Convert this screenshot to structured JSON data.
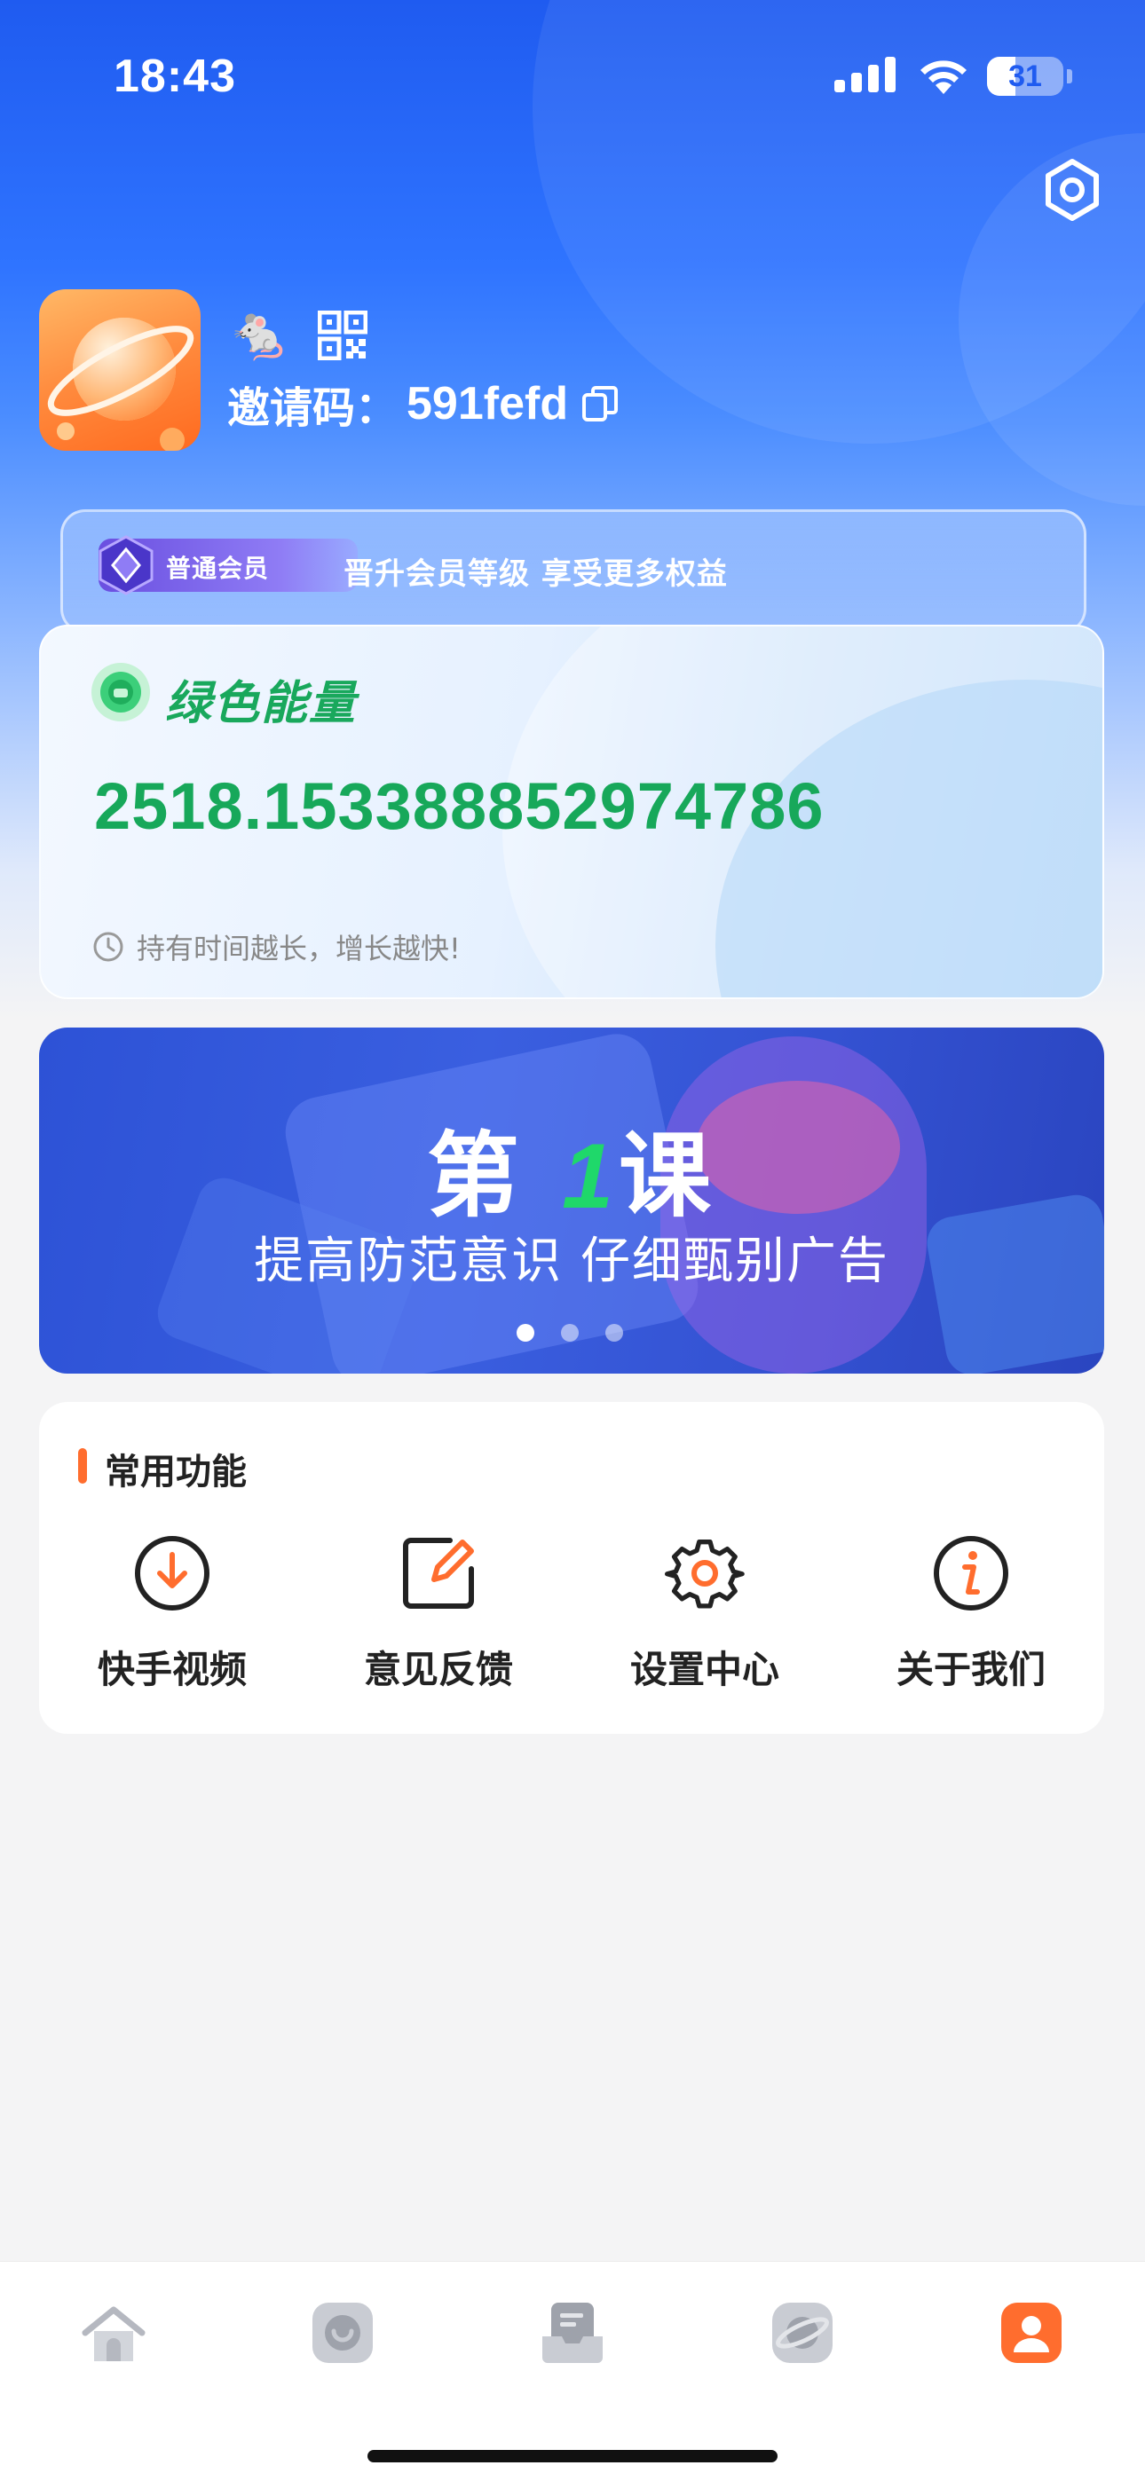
{
  "status_bar": {
    "time": "18:43",
    "battery": "31"
  },
  "profile": {
    "avatar_icon": "planet-avatar",
    "nickname_emoji": "🐁",
    "invite_label": "邀请码：",
    "invite_code": "591fefd"
  },
  "member": {
    "badge_label": "普通会员",
    "tip": "晋升会员等级  享受更多权益"
  },
  "energy": {
    "title": "绿色能量",
    "value": "2518.153388852974786",
    "hint": "持有时间越长，增长越快!"
  },
  "banner": {
    "title_prefix": "第 ",
    "title_number": "1",
    "title_suffix": "课",
    "subtitle": "提高防范意识   仔细甄别广告",
    "page_count": 3,
    "active_page": 1
  },
  "functions": {
    "title": "常用功能",
    "items": [
      {
        "label": "快手视频",
        "icon": "download-circle-icon"
      },
      {
        "label": "意见反馈",
        "icon": "edit-icon"
      },
      {
        "label": "设置中心",
        "icon": "gear-icon"
      },
      {
        "label": "关于我们",
        "icon": "info-icon"
      }
    ]
  },
  "tabbar": {
    "tabs": [
      "home-icon",
      "smile-icon",
      "inbox-icon",
      "planet-icon",
      "profile-icon"
    ],
    "active": 4
  },
  "colors": {
    "brand_blue": "#2f74ff",
    "energy_green": "#17a85a",
    "accent_orange": "#ff6d2e"
  }
}
